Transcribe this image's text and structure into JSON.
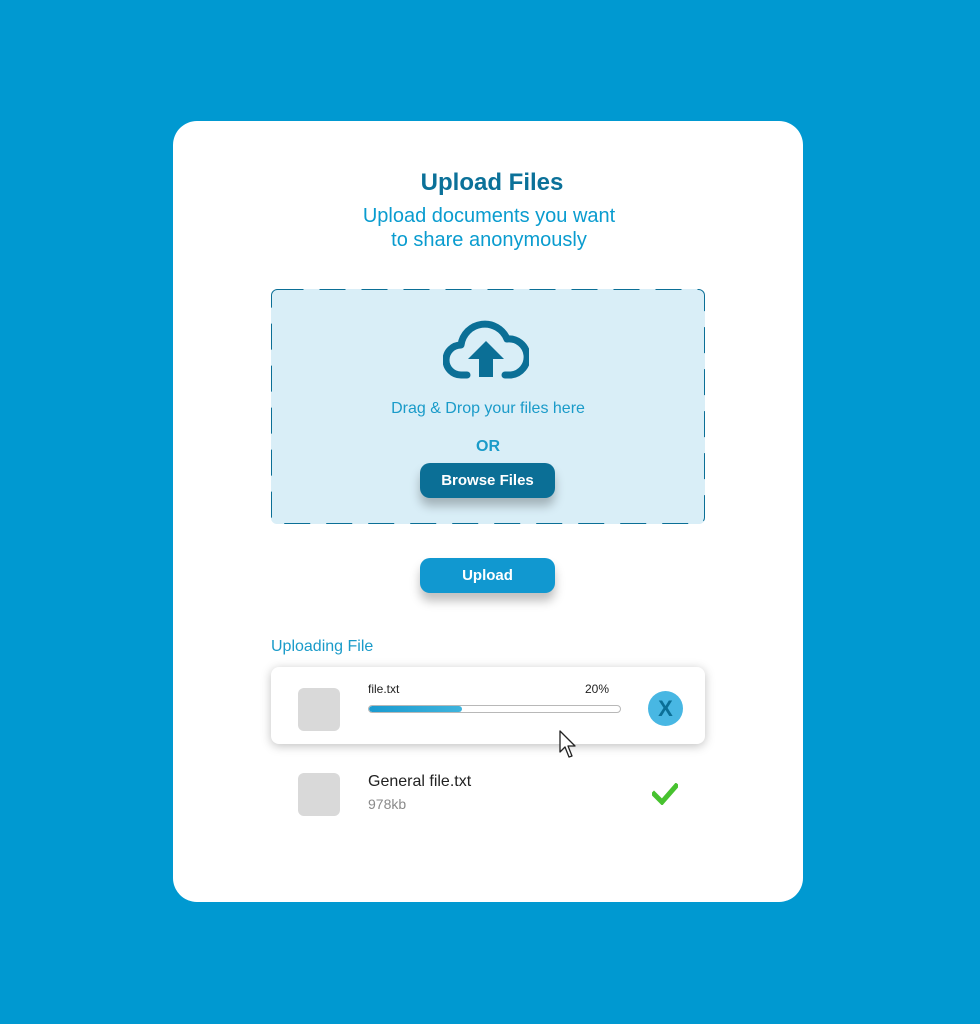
{
  "header": {
    "title": "Upload Files",
    "subtitle": "Upload documents you want\nto share anonymously"
  },
  "dropzone": {
    "icon": "cloud-upload-icon",
    "drag_text": "Drag & Drop your files here",
    "or_text": "OR",
    "browse_label": "Browse Files"
  },
  "actions": {
    "upload_label": "Upload"
  },
  "uploading": {
    "section_label": "Uploading File",
    "in_progress": {
      "name": "file.txt",
      "percent_text": "20%",
      "progress": 0.37,
      "cancel_label": "X"
    },
    "completed": [
      {
        "name": "General file.txt",
        "size": "978kb",
        "status_icon": "check-icon"
      }
    ]
  },
  "colors": {
    "background": "#0099d1",
    "primary_dark": "#0b6f96",
    "primary": "#1198d0",
    "dropzone_bg": "#d9eef7",
    "success": "#47c22f"
  }
}
